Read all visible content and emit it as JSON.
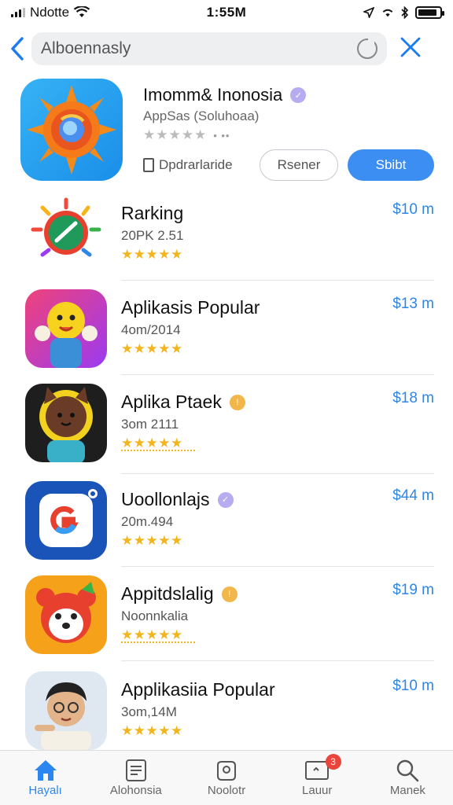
{
  "status_bar": {
    "carrier": "Ndotte",
    "time": "1:55M",
    "battery_level": 0.9
  },
  "search": {
    "back_icon": "chevron-left-icon",
    "value": "Alboennasly",
    "close_icon": "close-icon"
  },
  "featured": {
    "title": "Imomm& Inonosia",
    "subtitle": "AppSas (Soluhoaa)",
    "rating_stars": 5,
    "link_label": "Dpdrarlaride",
    "secondary_button": "Rsener",
    "primary_button": "Sbibt",
    "accent_color": "#3d8ef2"
  },
  "apps": [
    {
      "name": "Rarking",
      "meta": "20PK 2.51",
      "rating": 4.5,
      "price": "$10 m",
      "badge": ""
    },
    {
      "name": "Aplikasis Popular",
      "meta": "4om/2014",
      "rating": 4.5,
      "price": "$13 m",
      "badge": ""
    },
    {
      "name": "Aplika Ptaek",
      "meta": "3om 2111",
      "rating": 5,
      "price": "$18 m",
      "badge": "orange"
    },
    {
      "name": "Uoollonlajs",
      "meta": "20m.494",
      "rating": 4.5,
      "price": "$44 m",
      "badge": "purple"
    },
    {
      "name": "Appitdslalig",
      "meta": "Noonnkalia",
      "rating": 5,
      "price": "$19 m",
      "badge": "orange"
    },
    {
      "name": "Applikasiia Popular",
      "meta": "3om,14M",
      "rating": 4.5,
      "price": "$10 m",
      "badge": ""
    }
  ],
  "tabs": [
    {
      "label": "Hayalı",
      "icon": "home-icon",
      "active": true
    },
    {
      "label": "Alohonsia",
      "icon": "document-icon",
      "active": false
    },
    {
      "label": "Noolotr",
      "icon": "box-icon",
      "active": false
    },
    {
      "label": "Lauur",
      "icon": "tray-icon",
      "active": false,
      "badge": "3"
    },
    {
      "label": "Manek",
      "icon": "search-icon",
      "active": false
    }
  ]
}
